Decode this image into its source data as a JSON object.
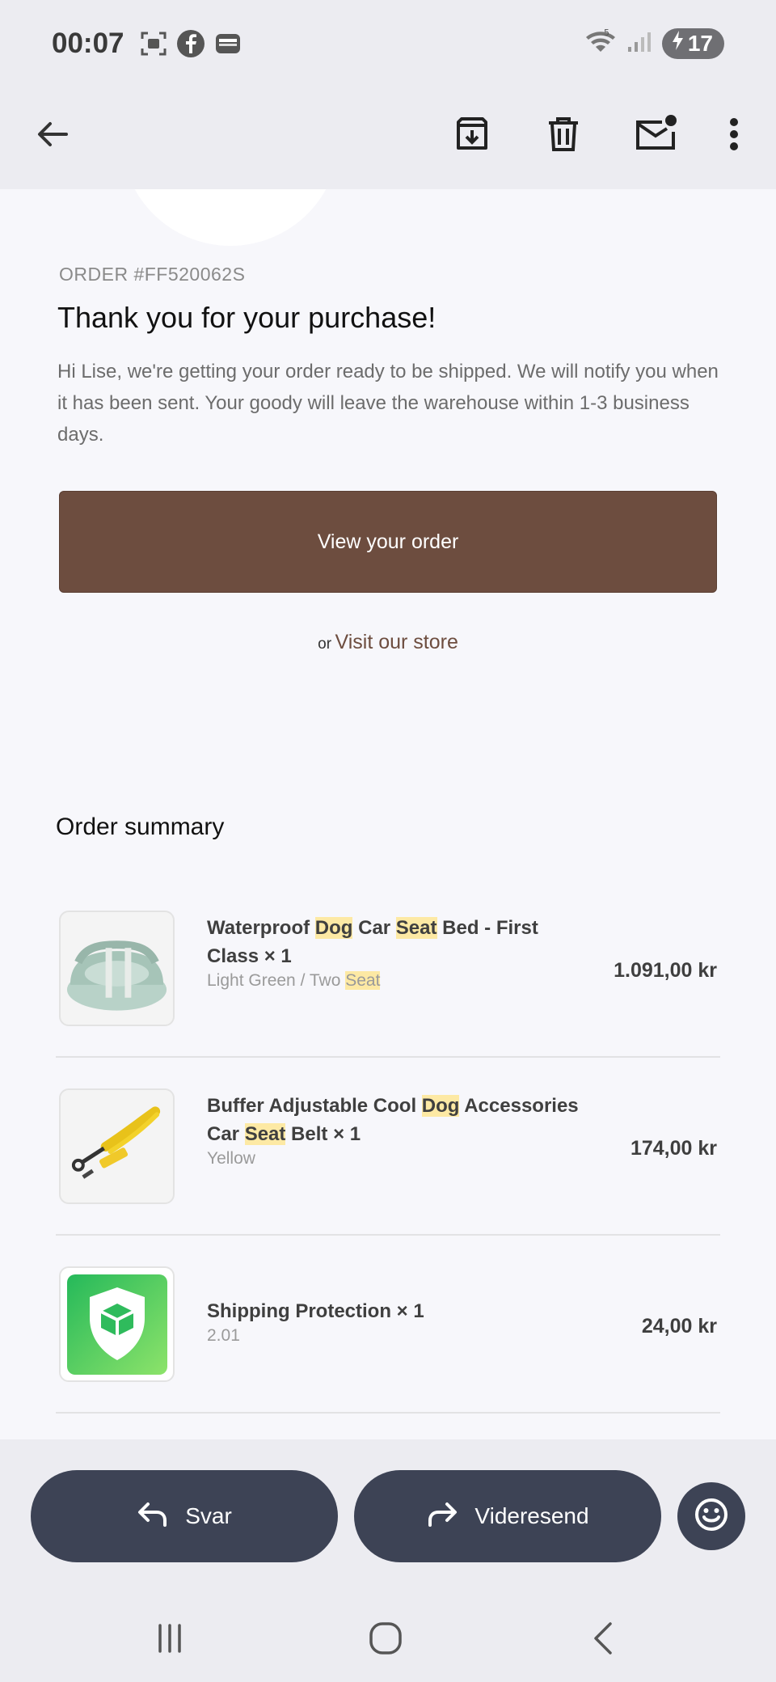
{
  "status_bar": {
    "time": "00:07",
    "battery": "17",
    "left_icons": [
      "screenshot-icon",
      "facebook-icon",
      "wallet-icon"
    ],
    "right_icons": [
      "wifi-icon",
      "signal-icon",
      "battery-icon"
    ]
  },
  "toolbar": {
    "icons": [
      "back-arrow-icon",
      "archive-icon",
      "trash-icon",
      "mark-unread-icon",
      "more-vertical-icon"
    ]
  },
  "email": {
    "order_number": "ORDER #FF520062S",
    "heading": "Thank you for your purchase!",
    "intro": "Hi Lise, we're getting your order ready to be shipped. We will notify you when it has been sent. Your goody will leave the warehouse within 1-3 business days.",
    "view_order_label": "View your order",
    "or_label": "or",
    "visit_store_label": "Visit our store",
    "summary_title": "Order summary",
    "brand_color": "#6d4d3f",
    "highlight_color": "#fde9a4",
    "items": [
      {
        "name_parts": [
          "Waterproof ",
          "Dog",
          " Car ",
          "Seat",
          " Bed - First Class × 1"
        ],
        "variant_parts": [
          "Light Green / Two ",
          "Seat"
        ],
        "price": "1.091,00 kr"
      },
      {
        "name_parts": [
          "Buffer Adjustable Cool ",
          "Dog",
          " Accessories Car ",
          "Seat",
          " Belt × 1"
        ],
        "variant": "Yellow",
        "price": "174,00 kr"
      },
      {
        "name": "Shipping Protection × 1",
        "variant": "2.01",
        "price": "24,00 kr"
      }
    ]
  },
  "actions": {
    "reply_label": "Svar",
    "forward_label": "Videresend",
    "button_color": "#3d4355"
  },
  "nav": {
    "icons": [
      "recent-apps-icon",
      "home-icon",
      "back-icon"
    ]
  }
}
